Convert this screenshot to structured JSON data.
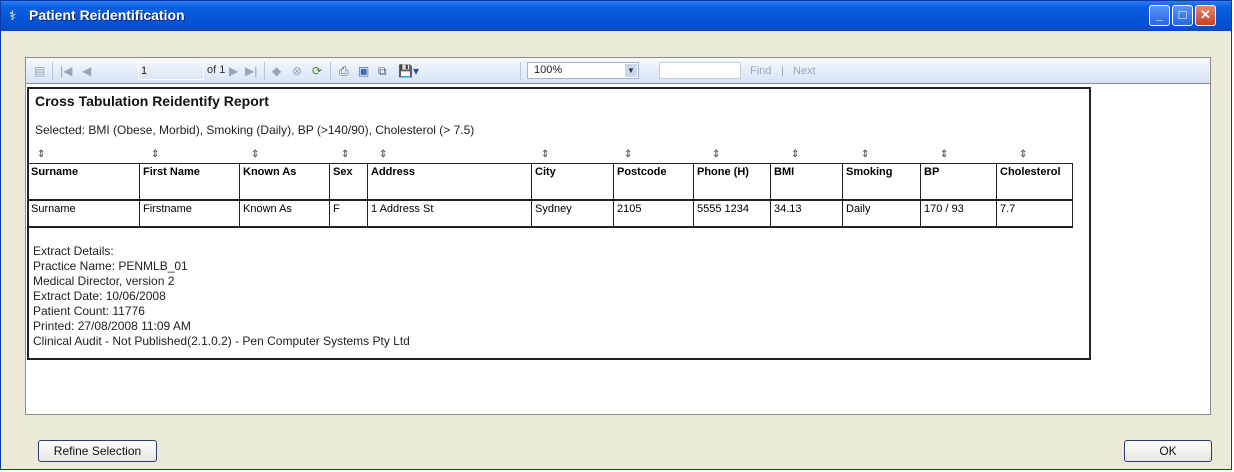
{
  "window": {
    "title": "Patient Reidentification"
  },
  "toolbar": {
    "page_value": "1",
    "page_of": "of 1",
    "zoom": "100%",
    "find_label": "Find",
    "separator": "|",
    "next_label": "Next",
    "icons": [
      "document-map-icon",
      "first-page-icon",
      "previous-page-icon",
      "next-page-icon",
      "last-page-icon",
      "back-icon",
      "stop-icon",
      "refresh-icon",
      "print-icon",
      "print-layout-icon",
      "page-setup-icon",
      "export-icon"
    ]
  },
  "report": {
    "title": "Cross Tabulation Reidentify Report",
    "selected": "Selected: BMI (Obese, Morbid), Smoking (Daily), BP (>140/90), Cholesterol (> 7.5)",
    "columns": [
      "Surname",
      "First Name",
      "Known As",
      "Sex",
      "Address",
      "City",
      "Postcode",
      "Phone (H)",
      "BMI",
      "Smoking",
      "BP",
      "Cholesterol"
    ],
    "rows": [
      [
        "Surname",
        "Firstname",
        "Known As",
        "F",
        "1 Address St",
        "Sydney",
        "2105",
        "5555 1234",
        "34.13",
        "Daily",
        "170 / 93",
        "7.7"
      ]
    ],
    "extract": [
      "Extract Details:",
      "Practice Name: PENMLB_01",
      "Medical Director, version 2",
      "Extract Date: 10/06/2008",
      "Patient Count: 11776",
      "Printed: 27/08/2008 11:09 AM",
      "Clinical Audit - Not Published(2.1.0.2) - Pen Computer Systems Pty Ltd"
    ]
  },
  "buttons": {
    "refine": "Refine Selection",
    "ok": "OK"
  }
}
